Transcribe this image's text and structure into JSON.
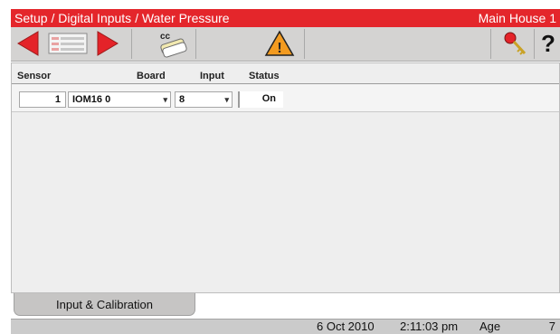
{
  "title": {
    "breadcrumb": "Setup / Digital Inputs / Water Pressure",
    "location": "Main House 1"
  },
  "toolbar": {
    "icons": [
      "back-arrow-icon",
      "list-view-icon",
      "forward-arrow-icon",
      "cc-copy-icon",
      "warning-icon",
      "keys-icon",
      "help-icon"
    ],
    "cc_label": "cc",
    "help_label": "?",
    "warning_glyph": "!"
  },
  "table": {
    "headers": [
      "Sensor",
      "Board",
      "Input",
      "Status"
    ],
    "rows": [
      {
        "sensor": "1",
        "board": "IOM16 0",
        "input": "8",
        "status": "On"
      }
    ],
    "dropdown_glyph": "▾"
  },
  "tabs": [
    {
      "label": "Input & Calibration"
    }
  ],
  "status_bar": {
    "date": "6 Oct 2010",
    "time": "2:11:03 pm",
    "age_label": "Age",
    "age_value": "7"
  },
  "colors": {
    "title_bar": "#e4262b",
    "arrow_red": "#e42329",
    "warning_orange": "#f39b20"
  }
}
